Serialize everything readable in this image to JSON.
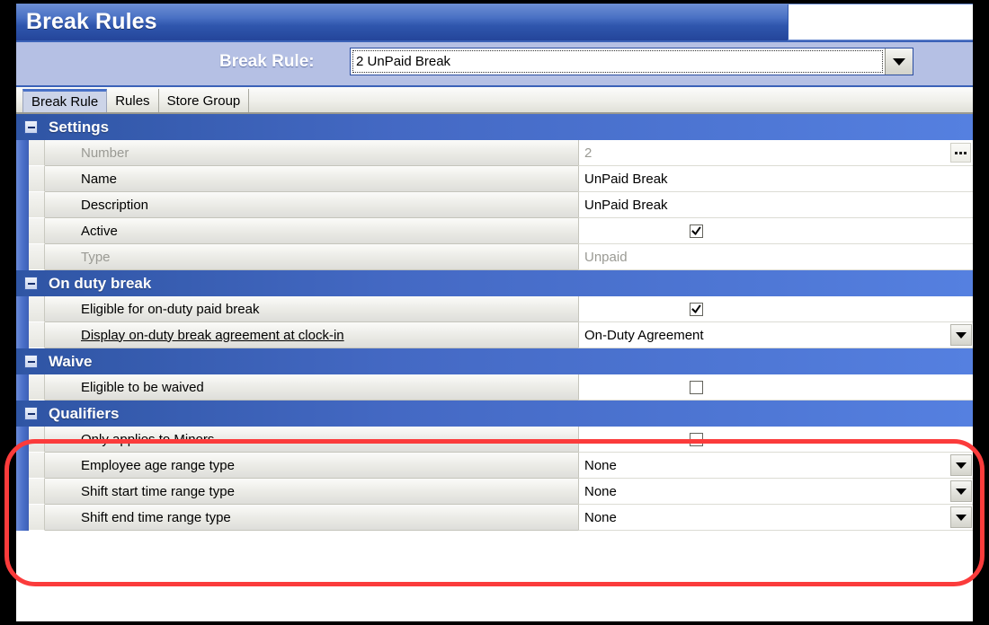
{
  "window": {
    "title": "Break Rules"
  },
  "selector": {
    "label": "Break Rule:",
    "value": "2  UnPaid Break",
    "dropdown_icon": "chevron-down-icon"
  },
  "tabs": [
    {
      "label": "Break Rule",
      "active": true
    },
    {
      "label": "Rules",
      "active": false
    },
    {
      "label": "Store Group",
      "active": false
    }
  ],
  "sections": [
    {
      "title": "Settings",
      "collapse_icon": "minus-box-icon",
      "rows": [
        {
          "label": "Number",
          "label_disabled": true,
          "value": "2",
          "value_disabled": true,
          "control": "ellipsis"
        },
        {
          "label": "Name",
          "label_disabled": false,
          "value": "UnPaid Break",
          "value_disabled": false,
          "control": "text"
        },
        {
          "label": "Description",
          "label_disabled": false,
          "value": "UnPaid Break",
          "value_disabled": false,
          "control": "text"
        },
        {
          "label": "Active",
          "label_disabled": false,
          "value": "",
          "value_disabled": false,
          "control": "checkbox",
          "checked": true
        },
        {
          "label": "Type",
          "label_disabled": true,
          "value": "Unpaid",
          "value_disabled": true,
          "control": "text"
        }
      ]
    },
    {
      "title": "On duty break",
      "collapse_icon": "minus-box-icon",
      "rows": [
        {
          "label": "Eligible for on-duty paid break",
          "label_disabled": false,
          "value": "",
          "value_disabled": false,
          "control": "checkbox",
          "checked": true
        },
        {
          "label": "Display on-duty break agreement at clock-in",
          "label_disabled": false,
          "underlined": true,
          "value": "On-Duty Agreement",
          "value_disabled": false,
          "control": "dropdown"
        }
      ]
    },
    {
      "title": "Waive",
      "collapse_icon": "minus-box-icon",
      "rows": [
        {
          "label": "Eligible to be waived",
          "label_disabled": false,
          "value": "",
          "value_disabled": false,
          "control": "checkbox",
          "checked": false
        }
      ]
    },
    {
      "title": "Qualifiers",
      "collapse_icon": "minus-box-icon",
      "highlighted": true,
      "rows": [
        {
          "label": "Only applies to Minors",
          "label_disabled": false,
          "value": "",
          "value_disabled": false,
          "control": "checkbox",
          "checked": false
        },
        {
          "label": "Employee age range type",
          "label_disabled": false,
          "value": "None",
          "value_disabled": false,
          "control": "dropdown"
        },
        {
          "label": "Shift start time range type",
          "label_disabled": false,
          "value": "None",
          "value_disabled": false,
          "control": "dropdown"
        },
        {
          "label": "Shift end time range type",
          "label_disabled": false,
          "value": "None",
          "value_disabled": false,
          "control": "dropdown"
        }
      ]
    }
  ],
  "annotation": {
    "shape": "rounded-rectangle",
    "color": "#fb3b3b",
    "targets": "Qualifiers"
  },
  "colors": {
    "title_bar_blue": "#2f56ad",
    "selector_bar": "#b5c0e4",
    "section_header_start": "#2f55a4",
    "section_header_end": "#5580e0",
    "gutter_blue": "#4a6fc8",
    "annotation_red": "#fb3b3b"
  }
}
